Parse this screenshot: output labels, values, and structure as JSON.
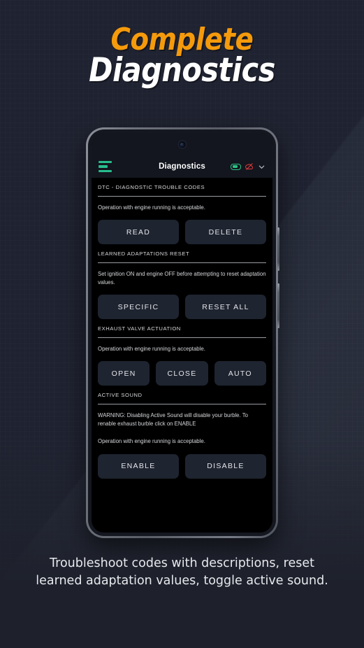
{
  "headline": {
    "line1": "Complete",
    "line2": "Diagnostics",
    "accent_color": "#F59A0B",
    "line2_color": "#FFFFFF"
  },
  "phone": {
    "app_bar": {
      "menu_icon": "hamburger-menu-icon",
      "title": "Diagnostics",
      "status_icons": [
        {
          "name": "battery-icon",
          "color": "#2BC083"
        },
        {
          "name": "cloud-off-icon",
          "color": "#E03A3A"
        },
        {
          "name": "chevron-down-icon",
          "color": "#C9CBD0"
        }
      ]
    },
    "sections": [
      {
        "title": "DTC - DIAGNOSTIC TROUBLE CODES",
        "description": "Operation with engine running is acceptable.",
        "buttons": [
          "READ",
          "DELETE"
        ]
      },
      {
        "title": "LEARNED ADAPTATIONS RESET",
        "description": "Set ignition ON and engine OFF before attempting to reset adaptation values.",
        "buttons": [
          "SPECIFIC",
          "RESET ALL"
        ]
      },
      {
        "title": "EXHAUST VALVE ACTUATION",
        "description": "Operation with engine running is acceptable.",
        "buttons": [
          "OPEN",
          "CLOSE",
          "AUTO"
        ]
      },
      {
        "title": "ACTIVE SOUND",
        "warning": "WARNING: Disabling Active Sound will disable your burble. To renable exhaust burble click on ENABLE",
        "description": "Operation with engine running is acceptable.",
        "buttons": [
          "ENABLE",
          "DISABLE"
        ]
      }
    ]
  },
  "caption": "Troubleshoot codes with descriptions, reset learned adaptation values, toggle active sound."
}
